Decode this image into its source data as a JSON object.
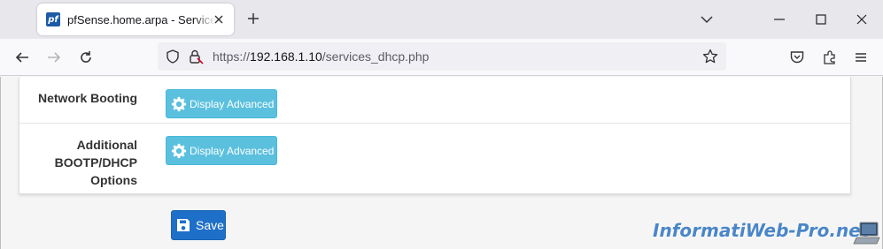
{
  "browser": {
    "tab": {
      "favicon_text": "pf",
      "title": "pfSense.home.arpa - Services: DHCP"
    },
    "url": {
      "scheme": "https://",
      "host": "192.168.1.10",
      "path": "/services_dhcp.php"
    }
  },
  "form": {
    "rows": [
      {
        "label": "Network Booting",
        "button": "Display Advanced"
      },
      {
        "label_lines": [
          "Additional",
          "BOOTP/DHCP",
          "Options"
        ],
        "button": "Display Advanced"
      }
    ],
    "save_label": "Save"
  },
  "watermark": {
    "text": "InformatiWeb-Pro.net"
  },
  "colors": {
    "info_button": "#5bc0de",
    "primary_button": "#1e6fc8",
    "favicon": "#1d5aa8"
  }
}
